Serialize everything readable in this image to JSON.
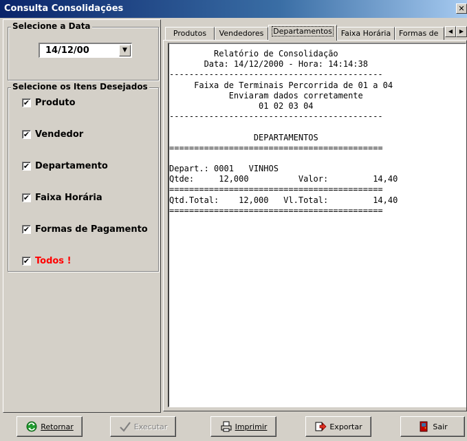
{
  "window": {
    "title": "Consulta Consolidações",
    "close_glyph": "✕"
  },
  "date_group": {
    "legend": "Selecione a Data",
    "value": "14/12/00",
    "dropdown_glyph": "▼"
  },
  "items_group": {
    "legend": "Selecione os Itens Desejados",
    "items": [
      {
        "label": "Produto",
        "checked": true
      },
      {
        "label": "Vendedor",
        "checked": true
      },
      {
        "label": "Departamento",
        "checked": true
      },
      {
        "label": "Faixa Horária",
        "checked": true
      },
      {
        "label": "Formas de Pagamento",
        "checked": true
      },
      {
        "label": "Todos !",
        "checked": true
      }
    ],
    "check_glyph": "✔"
  },
  "tabs": {
    "items": [
      "Produtos",
      "Vendedores",
      "Departamentos",
      "Faixa Horária",
      "Formas de"
    ],
    "active_index": 2,
    "scroll_left": "◀",
    "scroll_right": "▶"
  },
  "report": {
    "lines": [
      "         Relatório de Consolidação",
      "       Data: 14/12/2000 - Hora: 14:14:38",
      "-------------------------------------------",
      "     Faixa de Terminais Percorrida de 01 a 04",
      "            Enviaram dados corretamente",
      "                  01 02 03 04",
      "-------------------------------------------",
      "",
      "                 DEPARTAMENTOS",
      "===========================================",
      "",
      "Depart.: 0001   VINHOS",
      "Qtde:     12,000          Valor:         14,40",
      "===========================================",
      "Qtd.Total:    12,000   Vl.Total:         14,40",
      "==========================================="
    ]
  },
  "buttons": {
    "retornar": {
      "label": "Retornar",
      "icon": "refresh-icon"
    },
    "executar": {
      "label": "Executar",
      "icon": "checkmark-icon"
    },
    "imprimir": {
      "label": "Imprimir",
      "icon": "printer-icon"
    },
    "exportar": {
      "label": "Exportar",
      "icon": "export-icon"
    },
    "sair": {
      "label": "Sair",
      "icon": "exit-door-icon"
    }
  },
  "colors": {
    "title_bar": "#0a246a",
    "todos_label": "#ff0000",
    "face": "#d4d0c8"
  }
}
